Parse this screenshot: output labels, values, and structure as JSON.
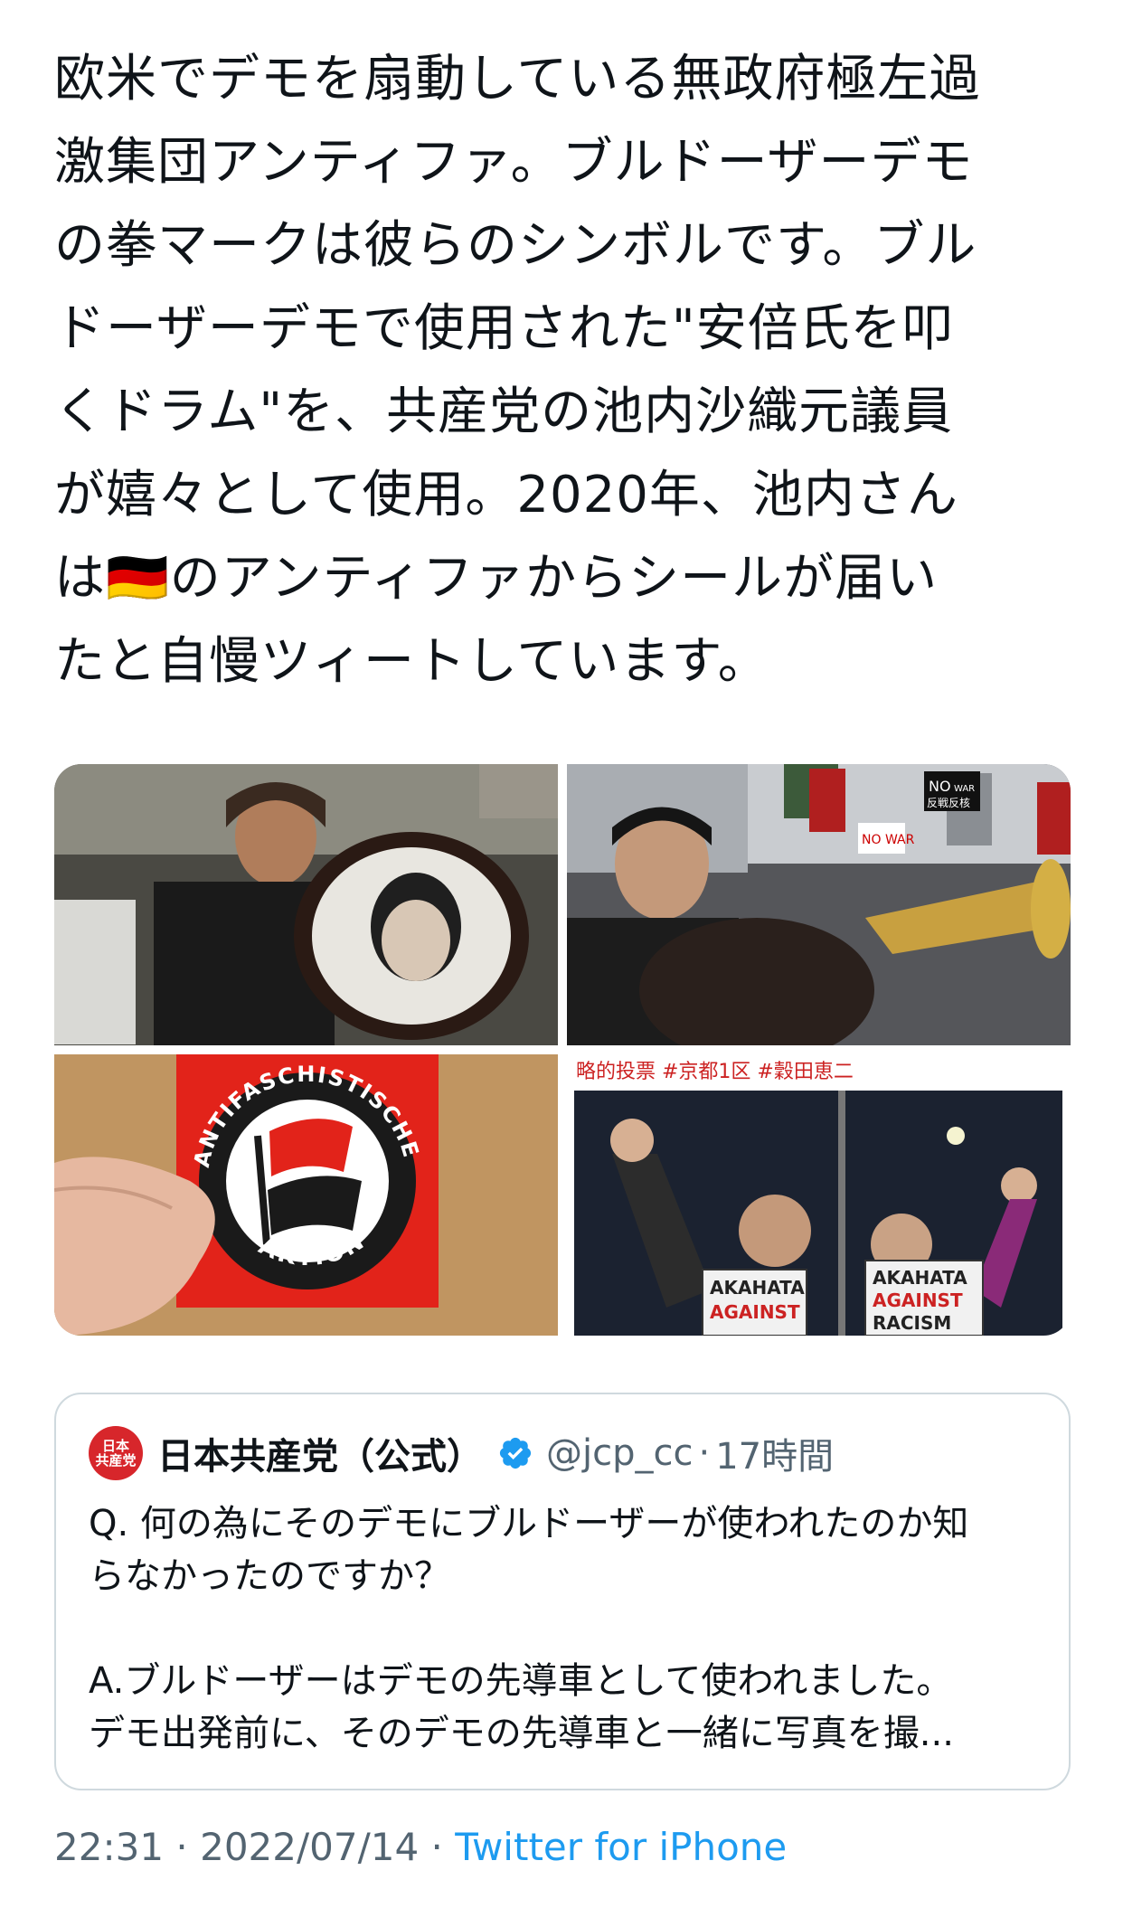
{
  "tweet": {
    "text": "欧米でデモを扇動している無政府極左過\n激集団アンティファ。ブルドーザーデモ\nの拳マークは彼らのシンボルです。ブル\nドーザーデモで使用された\"安倍氏を叩\nくドラム\"を、共産党の池内沙織元議員\nが嬉々として使用。2020年、池内さん\nは🇩🇪のアンティファからシールが届い\nたと自慢ツィートしています。"
  },
  "media": {
    "photo2_signs": [
      "NO",
      "WAR",
      "反戦反核",
      "NO WAR"
    ],
    "photo3_sticker_top": "ANTIFASCHISTISCHE",
    "photo3_sticker_bottom": "AKTION",
    "photo4_caption": "略的投票 #京都1区 #穀田恵二",
    "photo4_sign1_line1": "AKAHATA",
    "photo4_sign1_line2": "AGAINST",
    "photo4_sign2_line1": "AKAHATA",
    "photo4_sign2_line2": "AGAINST",
    "photo4_sign2_line3": "RACISM"
  },
  "quote": {
    "avatar_line1": "日本",
    "avatar_line2": "共産党",
    "name": "日本共産党（公式）",
    "handle": "@jcp_cc",
    "separator": "·",
    "time": "17時間",
    "body": "Q. 何の為にそのデモにブルドーザーが使われたのか知\nらなかったのですか？\n\nA.ブルドーザーはデモの先導車として使われました。\nデモ出発前に、そのデモの先導車と一緒に写真を撮..."
  },
  "meta": {
    "time": "22:31",
    "sep1": " · ",
    "date": "2022/07/14",
    "sep2": " · ",
    "source": "Twitter for iPhone"
  },
  "colors": {
    "text": "#0f1419",
    "secondary": "#536471",
    "link": "#1d9bf0",
    "border": "#cfd9de",
    "jcp_red": "#d7262b",
    "antifa_red": "#e2231a"
  }
}
